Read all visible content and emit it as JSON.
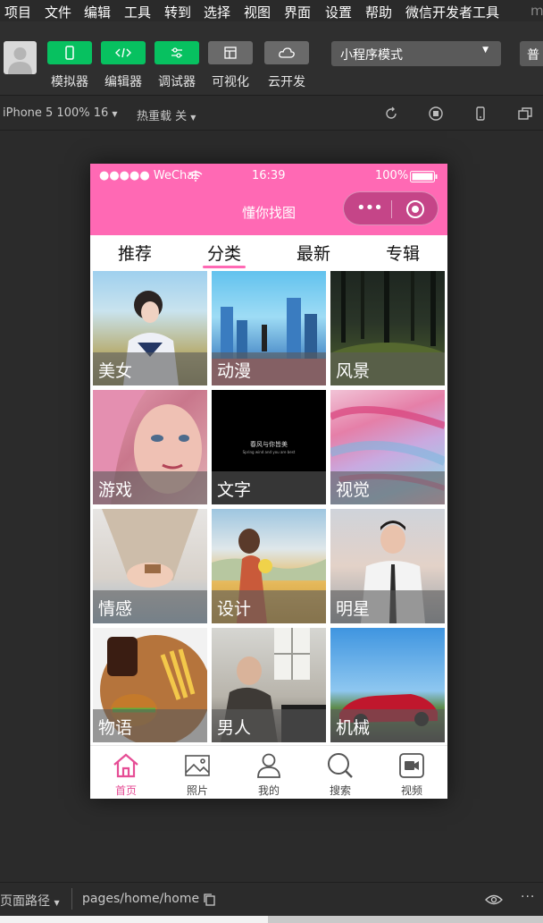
{
  "menu": [
    "项目",
    "文件",
    "编辑",
    "工具",
    "转到",
    "选择",
    "视图",
    "界面",
    "设置",
    "帮助",
    "微信开发者工具",
    "m"
  ],
  "toolbar": {
    "buttons": [
      {
        "label": "模拟器",
        "icon": "phone-icon"
      },
      {
        "label": "编辑器",
        "icon": "code-icon"
      },
      {
        "label": "调试器",
        "icon": "sliders-icon"
      },
      {
        "label": "可视化",
        "icon": "layout-icon"
      },
      {
        "label": "云开发",
        "icon": "cloud-icon"
      }
    ],
    "mode": "小程序模式",
    "mode2": "普"
  },
  "devbar": {
    "device": "iPhone 5 100% 16",
    "hotreload": "热重载 关"
  },
  "status": {
    "carrier": "●●●●● WeChat",
    "time": "16:39",
    "battery": "100%"
  },
  "nav": {
    "title": "懂你找图",
    "capsule_more": "•••"
  },
  "tabs": [
    "推荐",
    "分类",
    "最新",
    "专辑"
  ],
  "active_tab": 1,
  "categories": [
    "美女",
    "动漫",
    "风景",
    "游戏",
    "文字",
    "视觉",
    "情感",
    "设计",
    "明星",
    "物语",
    "男人",
    "机械"
  ],
  "text_image": {
    "line1": "春风与你皆美",
    "line2": "Spring wind and you are best"
  },
  "tabbar": [
    {
      "label": "首页",
      "icon": "home-icon"
    },
    {
      "label": "照片",
      "icon": "image-icon"
    },
    {
      "label": "我的",
      "icon": "user-icon"
    },
    {
      "label": "搜索",
      "icon": "search-icon"
    },
    {
      "label": "视频",
      "icon": "video-icon"
    }
  ],
  "bottom": {
    "path_label": "页面路径",
    "path": "pages/home/home"
  },
  "colors": {
    "accent": "#ff69b4",
    "active_tab": "#e64d95",
    "green": "#07c160"
  }
}
